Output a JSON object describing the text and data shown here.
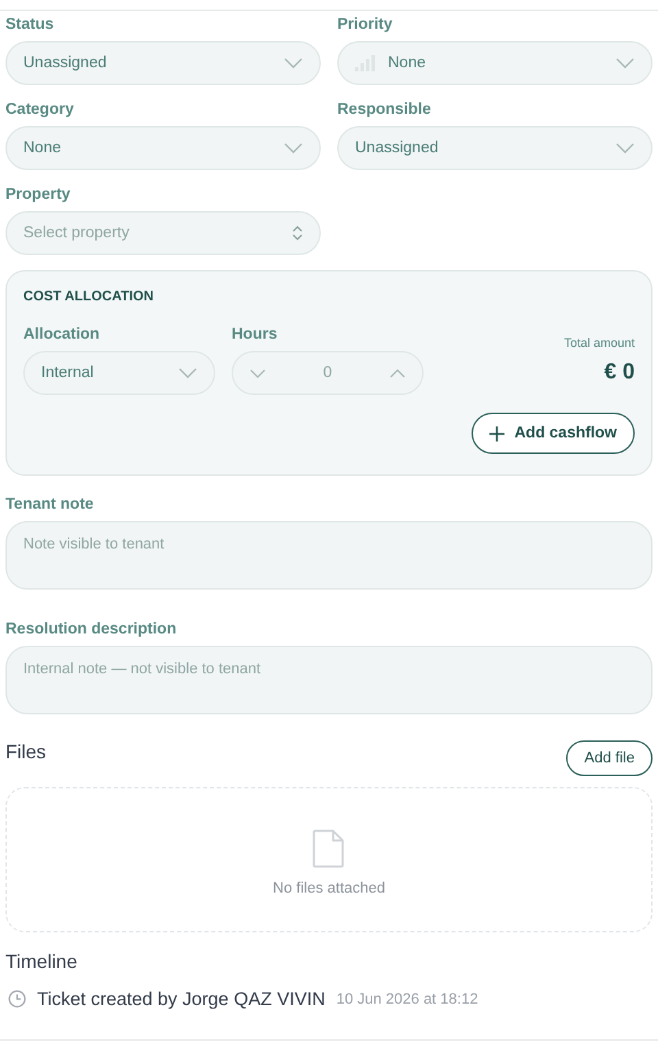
{
  "fields": [
    {
      "label": "Status",
      "kind": "select",
      "value": "Unassigned"
    },
    {
      "label": "Priority",
      "kind": "priority",
      "value": "None"
    },
    {
      "label": "Category",
      "kind": "select",
      "value": "None"
    },
    {
      "label": "Responsible",
      "kind": "select",
      "value": "Unassigned"
    },
    {
      "label": "Property",
      "kind": "picker",
      "placeholder": "Select property"
    }
  ],
  "cost_allocation": {
    "title": "COST ALLOCATION",
    "allocation": {
      "label": "Allocation",
      "value": "Internal"
    },
    "hours": {
      "label": "Hours",
      "value": "0"
    },
    "total_label": "Total amount",
    "total": "€ 0",
    "button": "Add cashflow"
  },
  "notes": [
    {
      "label": "Tenant note",
      "placeholder": "Note visible to tenant"
    },
    {
      "label": "Resolution description",
      "placeholder": "Internal note — not visible to tenant"
    }
  ],
  "files": {
    "title": "Files",
    "button": "Add file",
    "empty": "No files attached"
  },
  "timeline": {
    "title": "Timeline",
    "entries": [
      {
        "text": "Ticket created by Jorge QAZ VIVIN",
        "time": "10 Jun 2026 at 18:12"
      }
    ]
  }
}
